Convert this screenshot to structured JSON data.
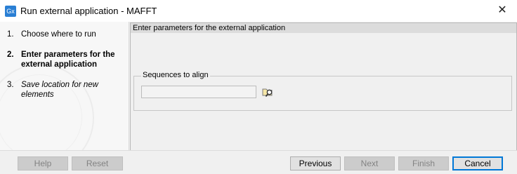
{
  "window": {
    "app_icon_text": "Gx",
    "title": "Run external application - MAFFT",
    "close_glyph": "✕"
  },
  "steps": [
    {
      "num": "1.",
      "label": "Choose where to run"
    },
    {
      "num": "2.",
      "label": "Enter parameters for the external application"
    },
    {
      "num": "3.",
      "label": "Save location for new elements"
    }
  ],
  "main": {
    "header": "Enter parameters for the external application",
    "sequences_group": {
      "legend": "Sequences to align",
      "input_value": ""
    }
  },
  "buttons": {
    "help": "Help",
    "reset": "Reset",
    "previous": "Previous",
    "next": "Next",
    "finish": "Finish",
    "cancel": "Cancel"
  },
  "colors": {
    "accent": "#0078d7",
    "app_icon": "#2a7fd4"
  }
}
